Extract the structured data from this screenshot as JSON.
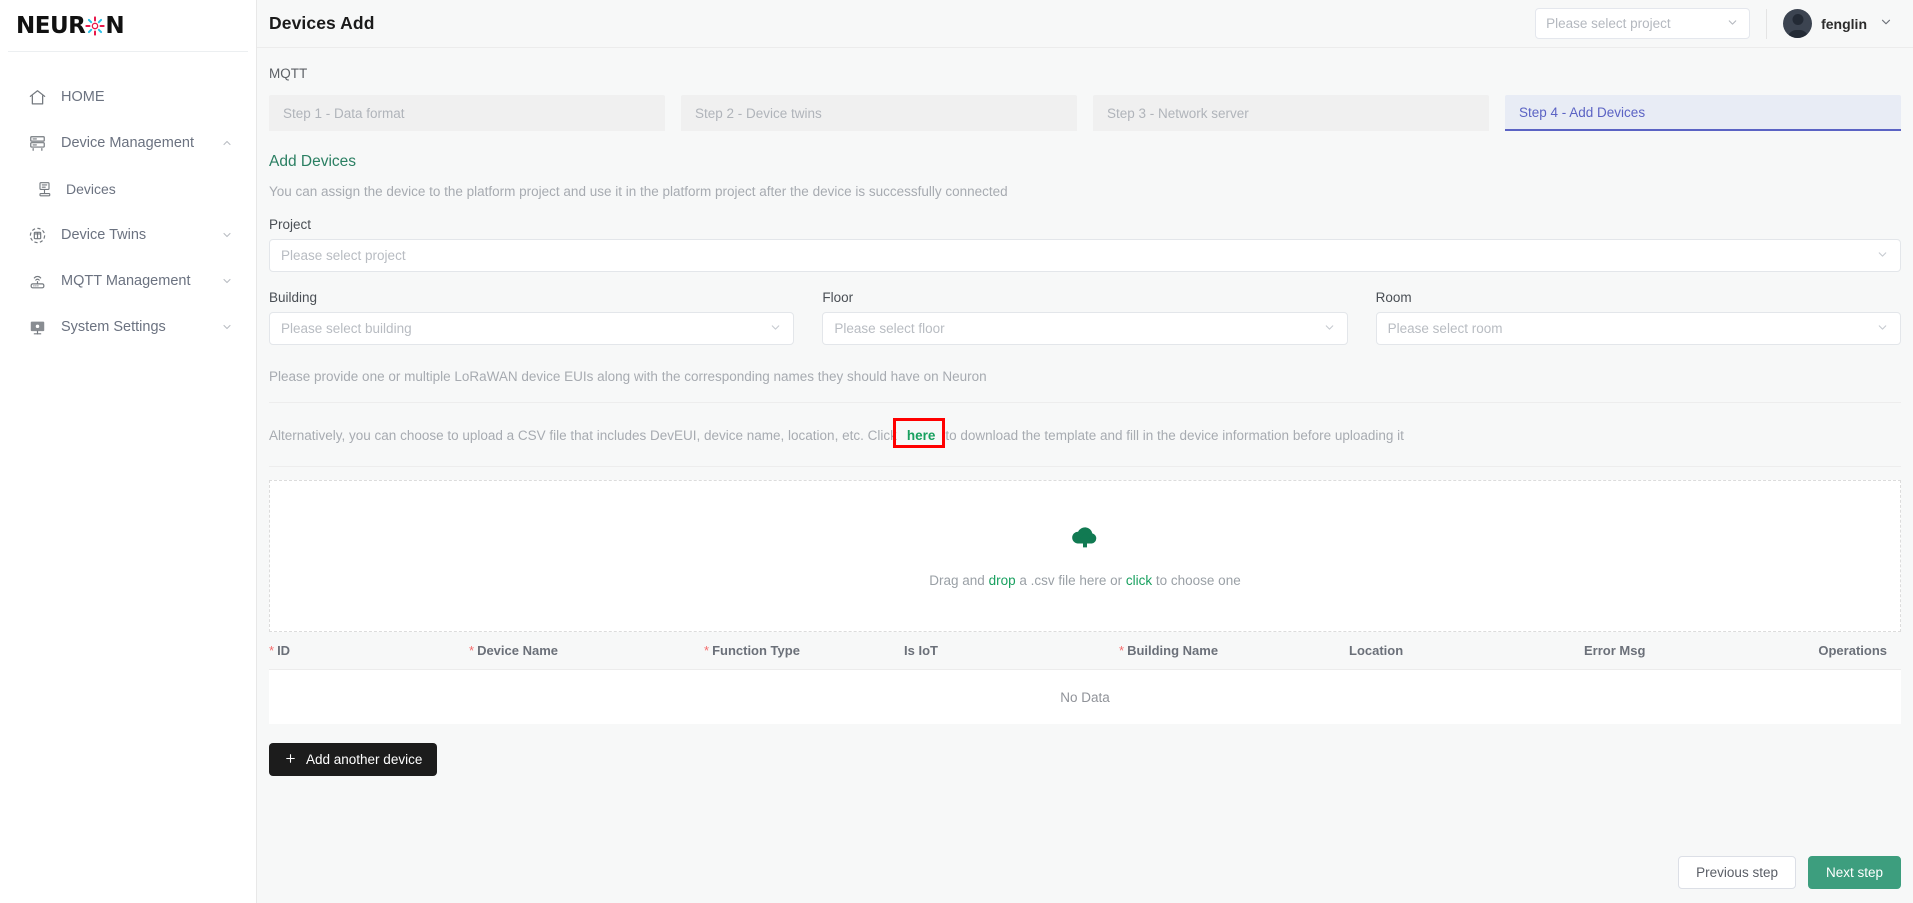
{
  "brand": {
    "name_part1": "NEUR",
    "name_part2": "N",
    "mark_icon": "gear-flower-icon"
  },
  "sidebar": {
    "items": [
      {
        "label": "HOME",
        "icon": "home-icon",
        "expandable": false,
        "sub": false
      },
      {
        "label": "Device Management",
        "icon": "server-icon",
        "expandable": true,
        "expanded": true,
        "sub": false
      },
      {
        "label": "Devices",
        "icon": "device-list-icon",
        "expandable": false,
        "sub": true
      },
      {
        "label": "Device Twins",
        "icon": "target-cube-icon",
        "expandable": true,
        "expanded": false,
        "sub": false
      },
      {
        "label": "MQTT Management",
        "icon": "router-icon",
        "expandable": true,
        "expanded": false,
        "sub": false
      },
      {
        "label": "System Settings",
        "icon": "monitor-icon",
        "expandable": true,
        "expanded": false,
        "sub": false
      }
    ]
  },
  "topbar": {
    "title": "Devices Add",
    "project_select_placeholder": "Please select project",
    "user_name": "fenglin",
    "user_chevron_icon": "chevron-down-icon",
    "project_chevron_icon": "chevron-down-icon"
  },
  "main": {
    "breadcrumb": "MQTT",
    "steps": [
      {
        "label": "Step 1 - Data format",
        "active": false
      },
      {
        "label": "Step 2 - Device twins",
        "active": false
      },
      {
        "label": "Step 3 - Network server",
        "active": false
      },
      {
        "label": "Step 4 - Add Devices",
        "active": true
      }
    ],
    "section_title": "Add Devices",
    "section_desc": "You can assign the device to the platform project and use it in the platform project after the device is successfully connected",
    "fields": {
      "project": {
        "label": "Project",
        "placeholder": "Please select project"
      },
      "building": {
        "label": "Building",
        "placeholder": "Please select building"
      },
      "floor": {
        "label": "Floor",
        "placeholder": "Please select floor"
      },
      "room": {
        "label": "Room",
        "placeholder": "Please select room"
      }
    },
    "hint1": "Please provide one or multiple LoRaWAN device EUIs along with the corresponding names they should have on Neuron",
    "hint2_before": "Alternatively, you can choose to upload a CSV file that includes DevEUI, device name, location, etc. Click",
    "hint2_link": "here",
    "hint2_after": "to download the template and fill in the device information before uploading it",
    "dropzone": {
      "icon": "cloud-upload-icon",
      "text_before": "Drag and ",
      "text_green1": "drop",
      "text_mid": " a .csv file here or ",
      "text_green2": "click",
      "text_after": " to choose one"
    },
    "table": {
      "columns": [
        {
          "label": "ID",
          "required": true
        },
        {
          "label": "Device Name",
          "required": true
        },
        {
          "label": "Function Type",
          "required": true
        },
        {
          "label": "Is IoT",
          "required": false
        },
        {
          "label": "Building Name",
          "required": true
        },
        {
          "label": "Location",
          "required": false
        },
        {
          "label": "Error Msg",
          "required": false
        },
        {
          "label": "Operations",
          "required": false
        }
      ],
      "empty_text": "No Data"
    },
    "add_device_button": "Add another device",
    "add_device_icon": "plus-icon",
    "previous_button": "Previous step",
    "next_button": "Next step"
  },
  "colors": {
    "accent_green": "#2a7f62",
    "link_green": "#18a05f",
    "step_active": "#5b63c4",
    "primary_button": "#3d9e7e",
    "required_red": "#f56c6c",
    "highlight_red": "#ff0000"
  }
}
